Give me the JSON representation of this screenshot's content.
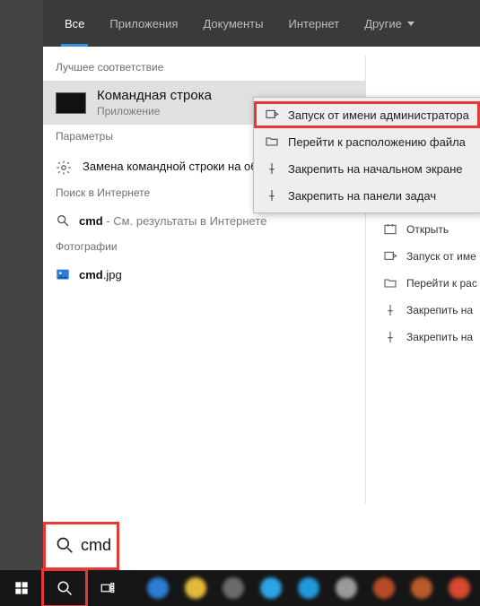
{
  "tabs": {
    "all": "Все",
    "apps": "Приложения",
    "documents": "Документы",
    "internet": "Интернет",
    "more": "Другие"
  },
  "sections": {
    "best_match": "Лучшее соответствие",
    "settings": "Параметры",
    "web_search": "Поиск в Интернете",
    "photos": "Фотографии"
  },
  "best_match": {
    "title": "Командная строка",
    "subtitle": "Приложение"
  },
  "settings_item": {
    "text": "Замена командной строки на оболочку Windows PowerShe"
  },
  "web_item": {
    "prefix": "cmd",
    "suffix": " - См. результаты в Интернете"
  },
  "photo_item": {
    "prefix": "cmd",
    "suffix": ".jpg"
  },
  "context_menu": {
    "run_admin": "Запуск от имени администратора",
    "open_location": "Перейти к расположению файла",
    "pin_start": "Закрепить на начальном экране",
    "pin_taskbar": "Закрепить на панели задач"
  },
  "side_actions": {
    "open": "Открыть",
    "run_admin": "Запуск от име",
    "open_location": "Перейти к рас",
    "pin_start": "Закрепить на",
    "pin_taskbar": "Закрепить на"
  },
  "search": {
    "value": "cmd"
  },
  "colors": {
    "highlight": "#e53935",
    "accent": "#3393df"
  },
  "taskbar_dots": [
    "#2b7dd4",
    "#e2b93a",
    "#6b6b6b",
    "#2ea3e6",
    "#2099d8",
    "#9a9a9a",
    "#b54d28",
    "#b85b28",
    "#d74a2f"
  ]
}
